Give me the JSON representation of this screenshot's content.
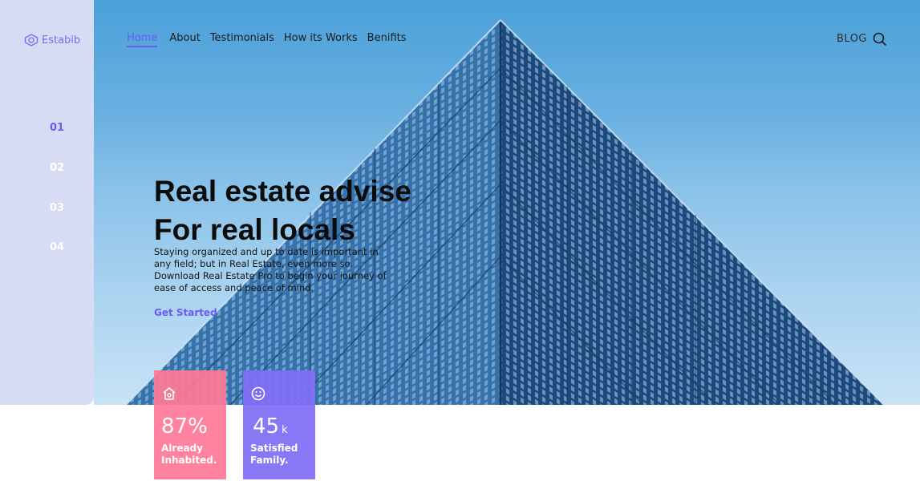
{
  "brand": {
    "name": "Estabib",
    "accent": "#6b5cf0"
  },
  "nav": {
    "items": [
      "Home",
      "About",
      "Testimonials",
      "How its Works",
      "Benifits"
    ],
    "blog_label": "BLOG",
    "search_icon": "search-icon"
  },
  "steps": [
    "01",
    "02",
    "03",
    "04"
  ],
  "hero": {
    "title_line1": "Real estate advise",
    "title_line2": "For real locals",
    "description": "Staying organized and up to date is important in any field; but in Real Estate, even more so. Download Real Estate Pro to begin your journey of ease of access and peace of mind.",
    "cta_label": "Get Started"
  },
  "stats": [
    {
      "icon": "home-icon",
      "value": "87%",
      "unit": "",
      "label": "Already Inhabited.",
      "color": "#ff7896"
    },
    {
      "icon": "smile-icon",
      "value": "45",
      "unit": "k",
      "label": "Satisfied Family.",
      "color": "#806ef5"
    }
  ]
}
